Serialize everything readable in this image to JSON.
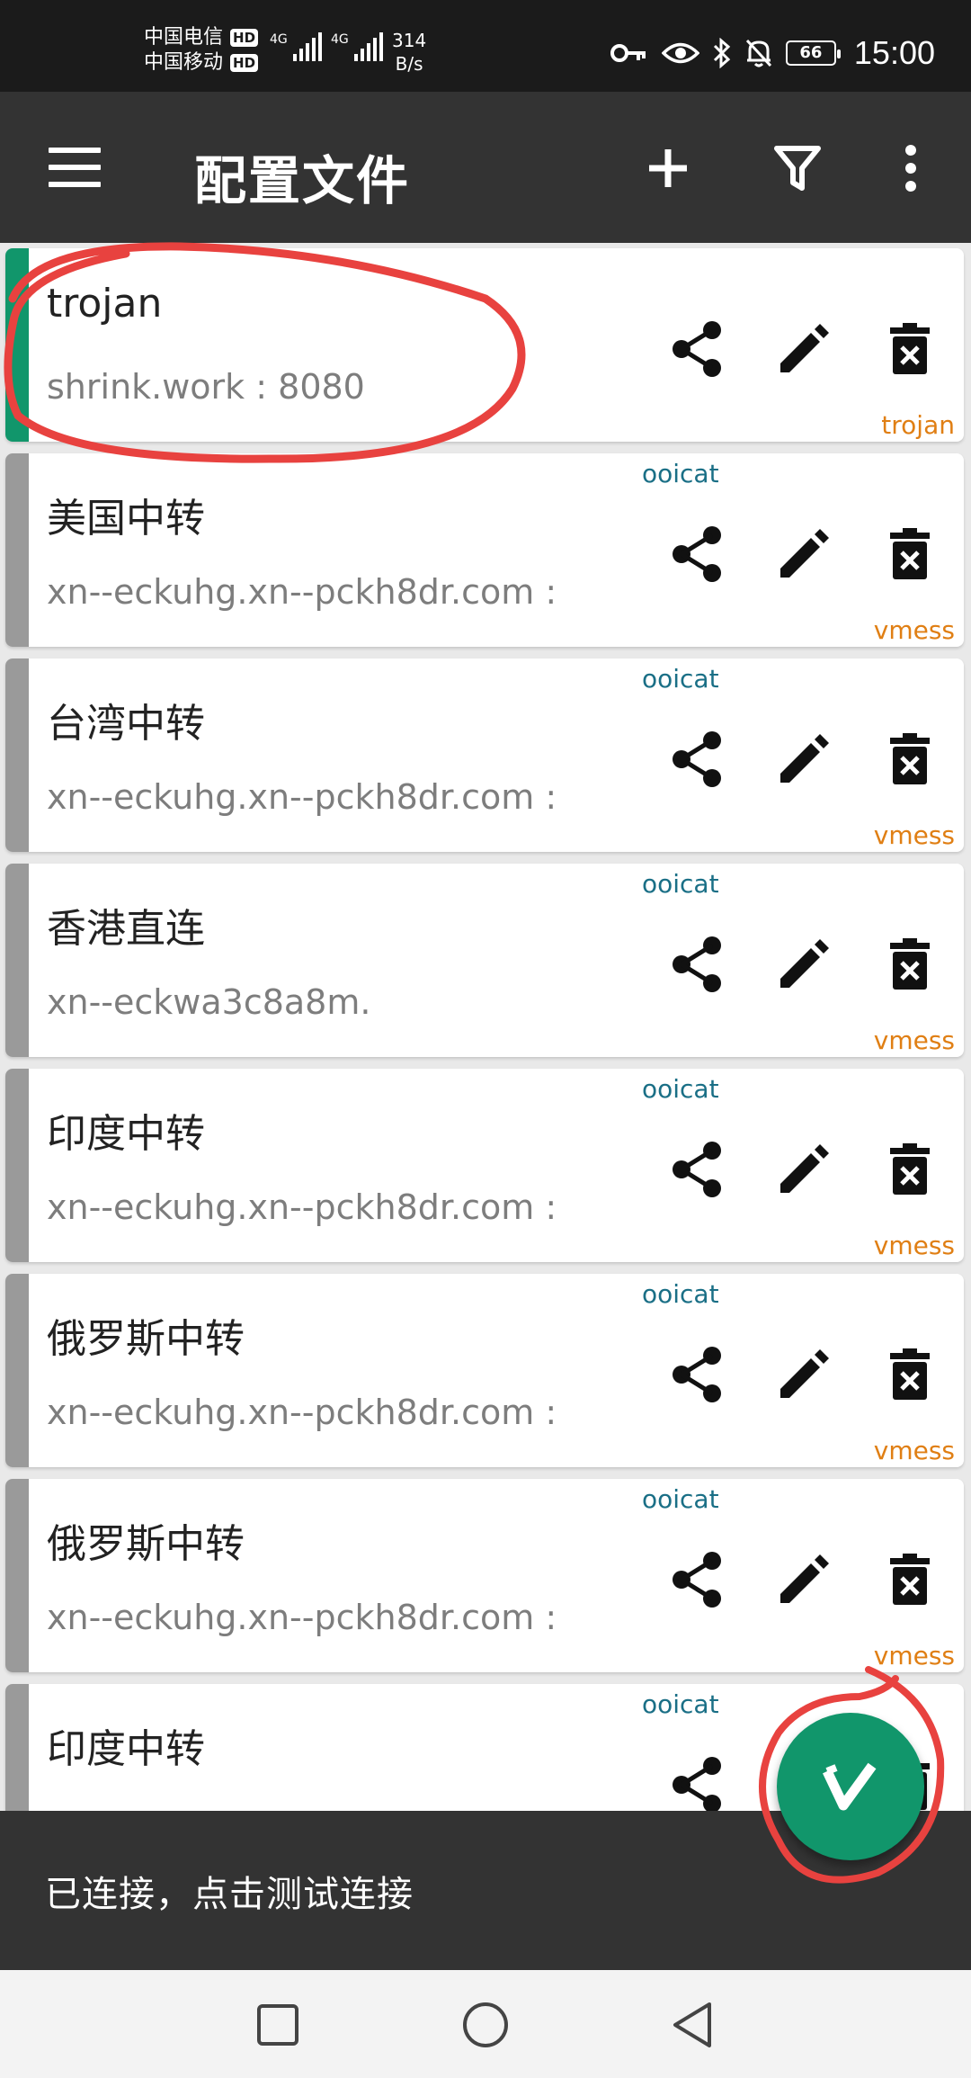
{
  "status_bar": {
    "carrier1": "中国电信",
    "carrier2": "中国移动",
    "hd_badge": "HD",
    "network1": "4G",
    "network2": "4G",
    "speed_value": "314",
    "speed_unit": "B/s",
    "battery": "66",
    "time": "15:00",
    "icons": [
      "key-icon",
      "eye-icon",
      "bluetooth-icon",
      "bell-off-icon",
      "battery-icon"
    ]
  },
  "app_bar": {
    "title": "配置文件",
    "icons": [
      "menu-icon",
      "plus-icon",
      "filter-icon",
      "more-vert-icon"
    ]
  },
  "profiles": [
    {
      "name": "trojan",
      "address": "shrink.work : 8080",
      "subscription": "",
      "type": "trojan",
      "active": true
    },
    {
      "name": "美国中转",
      "address": "xn--eckuhg.xn--pckh8dr.com :",
      "subscription": "ooicat",
      "type": "vmess",
      "active": false
    },
    {
      "name": "台湾中转",
      "address": "xn--eckuhg.xn--pckh8dr.com :",
      "subscription": "ooicat",
      "type": "vmess",
      "active": false
    },
    {
      "name": "香港直连",
      "address": "xn--eckwa3c8a8m.",
      "subscription": "ooicat",
      "type": "vmess",
      "active": false
    },
    {
      "name": "印度中转",
      "address": "xn--eckuhg.xn--pckh8dr.com :",
      "subscription": "ooicat",
      "type": "vmess",
      "active": false
    },
    {
      "name": "俄罗斯中转",
      "address": "xn--eckuhg.xn--pckh8dr.com :",
      "subscription": "ooicat",
      "type": "vmess",
      "active": false
    },
    {
      "name": "俄罗斯中转",
      "address": "xn--eckuhg.xn--pckh8dr.com :",
      "subscription": "ooicat",
      "type": "vmess",
      "active": false
    },
    {
      "name": "印度中转",
      "address": "",
      "subscription": "ooicat",
      "type": "",
      "active": false
    }
  ],
  "row_actions": [
    "share-icon",
    "edit-icon",
    "delete-icon"
  ],
  "status_message": "已连接，点击测试连接",
  "fab": {
    "icon": "v-logo-icon"
  },
  "nav_bar": [
    "recents-square-icon",
    "home-circle-icon",
    "back-triangle-icon"
  ],
  "colors": {
    "accent_green": "#11966b",
    "app_bar": "#333333",
    "subscription_text": "#1a6f86",
    "type_text": "#e07f14",
    "annotation_red": "#e8423f"
  }
}
